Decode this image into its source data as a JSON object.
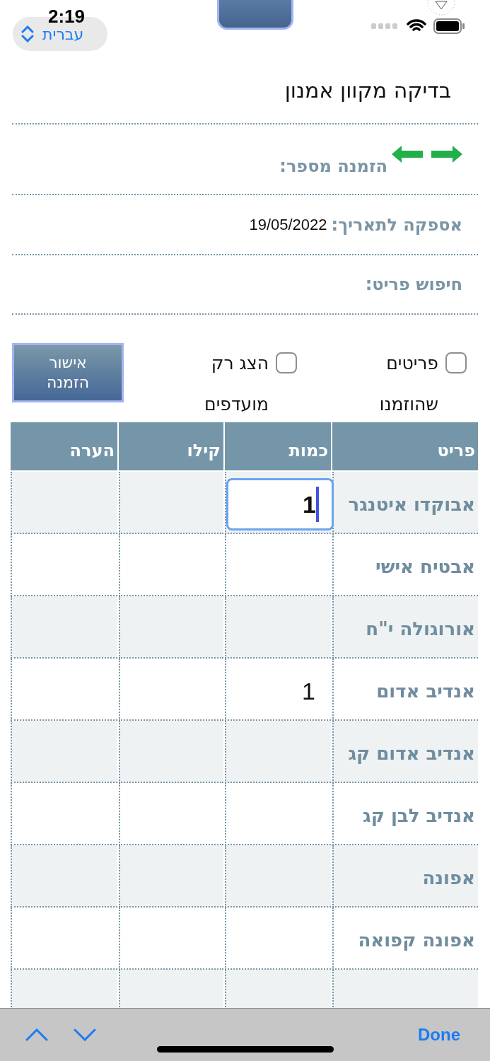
{
  "status_bar": {
    "time": "2:19",
    "language_button": "עברית"
  },
  "title": "בדיקה מקוון אמנון",
  "order_number": {
    "label": "הזמנה מספר:"
  },
  "delivery_date": {
    "label": "אספקה לתאריך:",
    "value": "19/05/2022"
  },
  "item_search": {
    "label": "חיפוש פריט:"
  },
  "filters": [
    {
      "label": "פריטים שהוזמנו",
      "checked": false
    },
    {
      "label": "הצג רק מועדפים",
      "checked": false
    }
  ],
  "confirm_button": "אישור הזמנה",
  "table": {
    "columns": [
      "פריט",
      "כמות",
      "קילו",
      "הערה"
    ],
    "rows": [
      {
        "item": "אבוקדו איטנגר",
        "quantity": "1",
        "focused": true
      },
      {
        "item": "אבטיח אישי",
        "focused": false
      },
      {
        "item": "אורוגולה י\"ח",
        "focused": false
      },
      {
        "item": "אנדיב אדום",
        "quantity": "1",
        "focused": false
      },
      {
        "item": "אנדיב אדום קג",
        "focused": false
      },
      {
        "item": "אנדיב לבן קג",
        "focused": false
      },
      {
        "item": "אפונה",
        "focused": false
      },
      {
        "item": "אפונה קפואה",
        "focused": false
      }
    ]
  },
  "keyboard_toolbar": {
    "done": "Done"
  }
}
